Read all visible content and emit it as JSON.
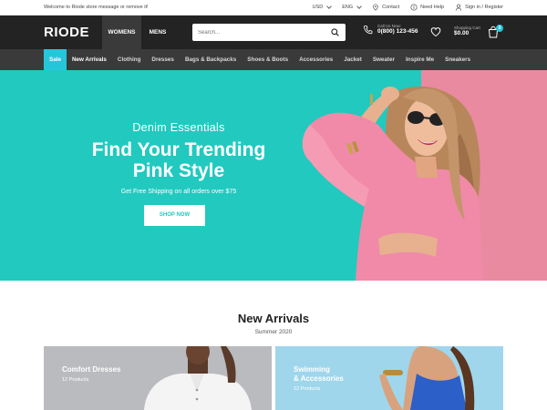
{
  "topbar": {
    "message": "Welcome to Riode store message or remove it!",
    "currency": "USD",
    "language": "ENG",
    "contact": "Contact",
    "help": "Need Help",
    "account": "Sign in / Register"
  },
  "header": {
    "logo": "RIODE",
    "tabs": [
      "WOMENS",
      "MENS"
    ],
    "search_placeholder": "Search...",
    "call_label": "Call Us Now:",
    "phone": "0(800) 123-456",
    "cart_label": "Shopping Cart",
    "cart_total": "$0.00",
    "cart_count": "0"
  },
  "nav": {
    "items": [
      "Sale",
      "New Arrivals",
      "Clothing",
      "Dresses",
      "Bags & Backpacks",
      "Shoes & Boots",
      "Accessories",
      "Jacket",
      "Sweater",
      "Inspire Me",
      "Sneakers"
    ]
  },
  "hero": {
    "subtitle": "Denim Essentials",
    "title_line1": "Find Your Trending",
    "title_line2": "Pink Style",
    "shipping": "Get Free Shipping on all orders over $75",
    "button": "SHOP NOW"
  },
  "arrivals": {
    "title": "New Arrivals",
    "subtitle": "Summer 2020",
    "cards": [
      {
        "title": "Comfort Dresses",
        "count": "12 Products"
      },
      {
        "title_line1": "Swimming",
        "title_line2": "& Accessories",
        "count": "12 Products"
      }
    ]
  },
  "colors": {
    "accent": "#26c6da",
    "hero_teal": "#22c9bf",
    "hero_pink": "#e98aa0",
    "header_dark": "#232323",
    "nav_dark": "#3a3a3a"
  }
}
